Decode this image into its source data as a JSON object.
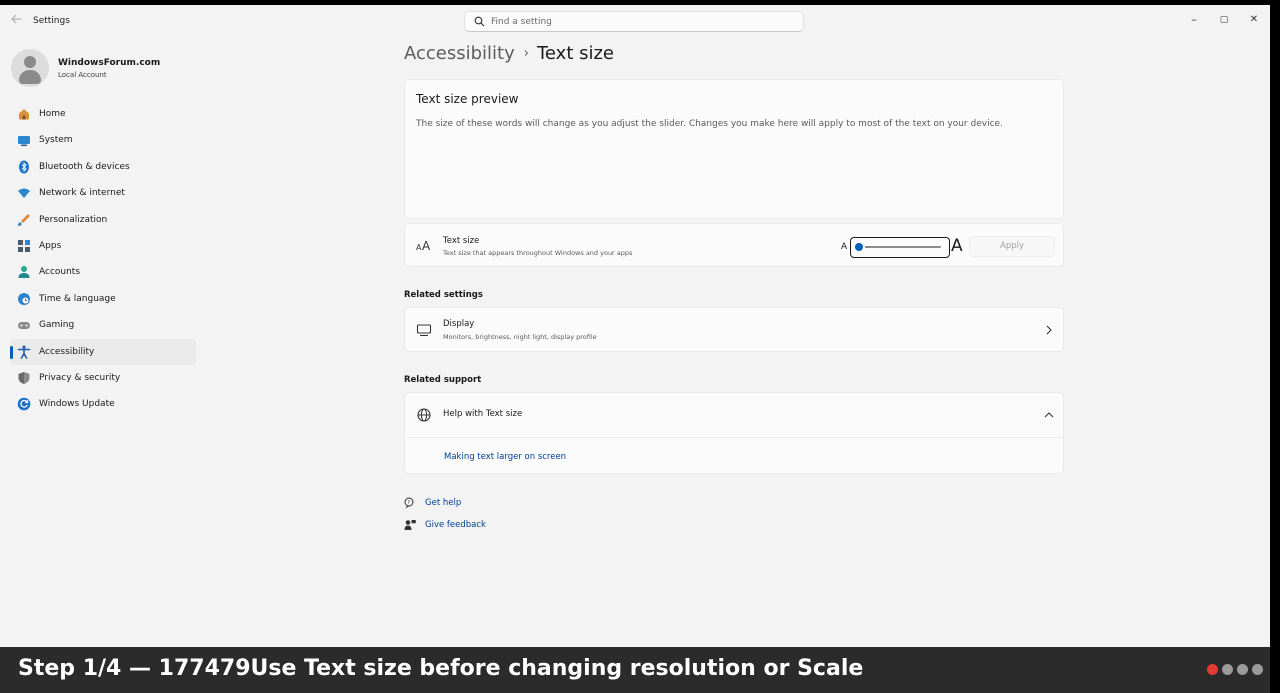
{
  "window": {
    "app_title": "Settings",
    "search_placeholder": "Find a setting",
    "controls": {
      "minimize": "–",
      "maximize": "▢",
      "close": "✕"
    }
  },
  "profile": {
    "name": "WindowsForum.com",
    "account_type": "Local Account"
  },
  "sidebar": {
    "items": [
      {
        "label": "Home",
        "icon": "home-icon",
        "color": "#c9813b"
      },
      {
        "label": "System",
        "icon": "system-icon",
        "color": "#2b86d0"
      },
      {
        "label": "Bluetooth & devices",
        "icon": "bluetooth-icon",
        "color": "#1a73c9"
      },
      {
        "label": "Network & internet",
        "icon": "wifi-icon",
        "color": "#2b86d0"
      },
      {
        "label": "Personalization",
        "icon": "brush-icon",
        "color": "#d06b2b"
      },
      {
        "label": "Apps",
        "icon": "apps-icon",
        "color": "#4a5a70"
      },
      {
        "label": "Accounts",
        "icon": "accounts-icon",
        "color": "#2aa88a"
      },
      {
        "label": "Time & language",
        "icon": "globe-clock-icon",
        "color": "#2b86d0"
      },
      {
        "label": "Gaming",
        "icon": "gamepad-icon",
        "color": "#7a7a7a"
      },
      {
        "label": "Accessibility",
        "icon": "accessibility-icon",
        "color": "#1a5fb0",
        "active": true
      },
      {
        "label": "Privacy & security",
        "icon": "shield-icon",
        "color": "#707070"
      },
      {
        "label": "Windows Update",
        "icon": "update-icon",
        "color": "#1a73c9"
      }
    ]
  },
  "breadcrumb": {
    "parent": "Accessibility",
    "separator": "›",
    "current": "Text size"
  },
  "preview": {
    "title": "Text size preview",
    "text": "The size of these words will change as you adjust the slider. Changes you make here will apply to most of the text on your device."
  },
  "text_size": {
    "title": "Text size",
    "subtitle": "Text size that appears throughout Windows and your apps",
    "slider_min_label": "A",
    "slider_max_label": "A",
    "slider_value_fraction": 0.0,
    "apply_label": "Apply"
  },
  "related_settings": {
    "heading": "Related settings",
    "display": {
      "title": "Display",
      "subtitle": "Monitors, brightness, night light, display profile"
    }
  },
  "related_support": {
    "heading": "Related support",
    "help_title": "Help with Text size",
    "link": "Making text larger on screen"
  },
  "footer": {
    "get_help": "Get help",
    "give_feedback": "Give feedback"
  },
  "overlay": {
    "step_text": "Step 1/4 — 177479Use Text size before changing resolution or Scale",
    "dots": [
      true,
      false,
      false,
      false
    ],
    "active_color": "#e53935"
  }
}
